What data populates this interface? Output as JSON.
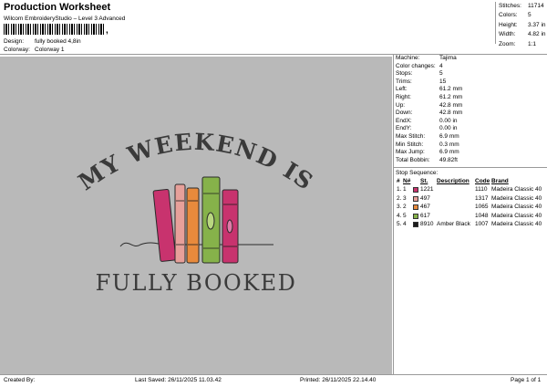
{
  "header": {
    "title": "Production Worksheet",
    "subtitle": "Wilcom EmbroideryStudio – Level 3 Advanced",
    "barcode_mark": ",",
    "design_label": "Design:",
    "design_value": "fully booked 4,8in",
    "colorway_label": "Colorway:",
    "colorway_value": "Colorway 1"
  },
  "stats": [
    {
      "label": "Stitches:",
      "value": "11714"
    },
    {
      "label": "Colors:",
      "value": "5"
    },
    {
      "label": "Height:",
      "value": "3.37 in"
    },
    {
      "label": "Width:",
      "value": "4.82 in"
    },
    {
      "label": "Zoom:",
      "value": "1:1"
    }
  ],
  "design": {
    "line1": "MY WEEKEND IS",
    "line2": "FULLY BOOKED"
  },
  "info": [
    {
      "label": "Machine:",
      "value": "Tajima"
    },
    {
      "label": "Color changes:",
      "value": "4"
    },
    {
      "label": "Stops:",
      "value": "5"
    },
    {
      "label": "Trims:",
      "value": "15"
    },
    {
      "label": "Left:",
      "value": "61.2 mm"
    },
    {
      "label": "Right:",
      "value": "61.2 mm"
    },
    {
      "label": "Up:",
      "value": "42.8 mm"
    },
    {
      "label": "Down:",
      "value": "42.8 mm"
    },
    {
      "label": "EndX:",
      "value": "0.00 in"
    },
    {
      "label": "EndY:",
      "value": "0.00 in"
    },
    {
      "label": "Max Stitch:",
      "value": "6.9 mm"
    },
    {
      "label": "Min Stitch:",
      "value": "0.3 mm"
    },
    {
      "label": "Max Jump:",
      "value": "6.9 mm"
    },
    {
      "label": "Total Bobbin:",
      "value": "49.82ft"
    }
  ],
  "stop_sequence": {
    "heading": "Stop Sequence:",
    "columns": {
      "num": "#",
      "n": "N#",
      "st": "St.",
      "desc": "Description",
      "code": "Code",
      "brand": "Brand"
    },
    "rows": [
      {
        "num": "1.",
        "n": "1",
        "color": "#c8336e",
        "st": "1221",
        "desc": "",
        "code": "1110",
        "brand": "Madeira Classic 40"
      },
      {
        "num": "2.",
        "n": "3",
        "color": "#e7a09a",
        "st": "497",
        "desc": "",
        "code": "1317",
        "brand": "Madeira Classic 40"
      },
      {
        "num": "3.",
        "n": "2",
        "color": "#e88a3c",
        "st": "467",
        "desc": "",
        "code": "1065",
        "brand": "Madeira Classic 40"
      },
      {
        "num": "4.",
        "n": "5",
        "color": "#86b24a",
        "st": "617",
        "desc": "",
        "code": "1048",
        "brand": "Madeira Classic 40"
      },
      {
        "num": "5.",
        "n": "4",
        "color": "#1c1c1c",
        "st": "8910",
        "desc": "Amber Black",
        "code": "1007",
        "brand": "Madeira Classic 40"
      }
    ]
  },
  "footer": {
    "created_by": "Created By:",
    "last_saved": "Last Saved: 26/11/2025 11.03.42",
    "printed": "Printed: 26/11/2025 22.14.40",
    "page": "Page 1 of 1"
  }
}
